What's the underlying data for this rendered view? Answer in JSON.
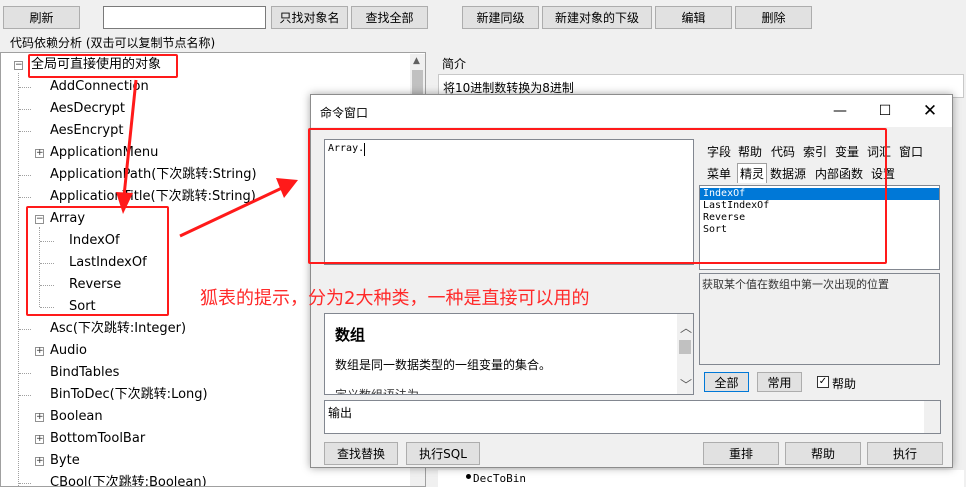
{
  "toolbar": {
    "refresh": "刷新",
    "search_value": "",
    "find_object": "只找对象名",
    "find_all": "查找全部",
    "new_sibling": "新建同级",
    "new_child": "新建对象的下级",
    "edit": "编辑",
    "delete": "删除"
  },
  "tree_header": "代码依赖分析 (双击可以复制节点名称)",
  "tree": {
    "root": "全局可直接使用的对象",
    "items": [
      "AddConnection",
      "AesDecrypt",
      "AesEncrypt",
      "ApplicationMenu",
      "ApplicationPath(下次跳转:String)",
      "ApplicationTitle(下次跳转:String)",
      "Array",
      "IndexOf",
      "LastIndexOf",
      "Reverse",
      "Sort",
      "Asc(下次跳转:Integer)",
      "Audio",
      "BindTables",
      "BinToDec(下次跳转:Long)",
      "Boolean",
      "BottomToolBar",
      "Byte",
      "CBool(下次跳转:Boolean)"
    ]
  },
  "right_panel": {
    "title": "简介",
    "desc": "将10进制数转换为8进制",
    "bottom_item": "DecToBin"
  },
  "dialog": {
    "title": "命令窗口",
    "code": "Array.",
    "tabs_row1": [
      "字段",
      "帮助",
      "代码",
      "索引",
      "变量",
      "词汇",
      "窗口"
    ],
    "tabs_row2": [
      "菜单",
      "精灵",
      "数据源",
      "内部函数",
      "设置"
    ],
    "list_items": [
      "IndexOf",
      "LastIndexOf",
      "Reverse",
      "Sort"
    ],
    "hint_text": "获取某个值在数组中第一次出现的位置",
    "help_title": "数组",
    "help_body": "数组是同一数据类型的一组变量的集合。",
    "help_more": "定义数组语法为",
    "filter_all": "全部",
    "filter_common": "常用",
    "filter_help": "帮助",
    "output_label": "输出",
    "find_replace": "查找替换",
    "exec_sql": "执行SQL",
    "rearrange": "重排",
    "help_btn": "帮助",
    "execute": "执行"
  },
  "annotation": "狐表的提示，分为2大种类，一种是直接可以用的",
  "colors": {
    "highlight": "#ff1a1a",
    "selection": "#0078d7"
  }
}
